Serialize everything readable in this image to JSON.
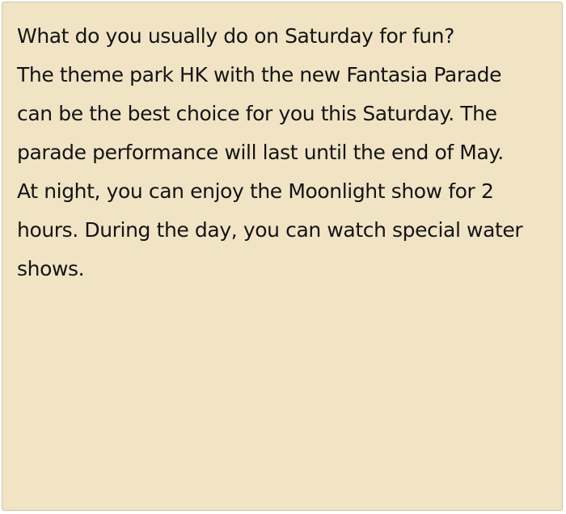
{
  "passage": {
    "lines": [
      "What do you usually do on Saturday for fun?",
      "The theme park HK with the new Fantasia Parade",
      "can be the best choice for you this Saturday. The",
      "parade performance will last until the end of May.",
      "At night, you can enjoy the Moonlight show for 2",
      "hours. During the day, you can watch special water",
      "shows."
    ]
  },
  "colors": {
    "background": "#f1e4c5",
    "text": "#141414"
  }
}
